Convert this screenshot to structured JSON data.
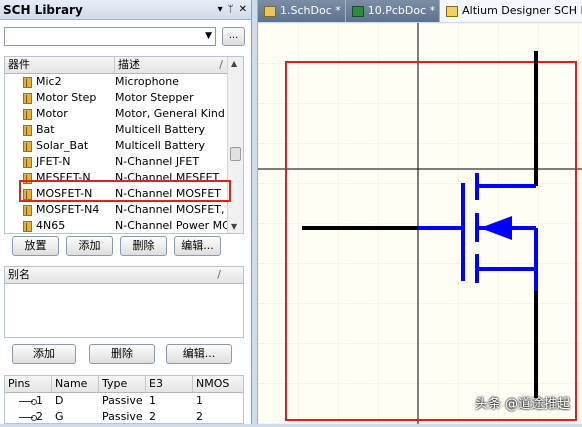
{
  "panel": {
    "title": "SCH Library",
    "ctrl_dropdown": "▾",
    "ctrl_pin": "ᛘ",
    "ctrl_close": "✕",
    "filter_value": "",
    "browse_label": "..."
  },
  "components": {
    "headers": [
      "器件",
      "描述"
    ],
    "rows": [
      {
        "name": "Mic2",
        "desc": "Microphone"
      },
      {
        "name": "Motor Step",
        "desc": "Motor Stepper"
      },
      {
        "name": "Motor",
        "desc": "Motor, General Kind"
      },
      {
        "name": "Bat",
        "desc": "Multicell Battery"
      },
      {
        "name": "Solar_Bat",
        "desc": "Multicell Battery"
      },
      {
        "name": "JFET-N",
        "desc": "N-Channel JFET"
      },
      {
        "name": "MESFET-N",
        "desc": "N-Channel MESFET"
      },
      {
        "name": "MOSFET-N",
        "desc": "N-Channel MOSFET"
      },
      {
        "name": "MOSFET-N4",
        "desc": "N-Channel MOSFET, I"
      },
      {
        "name": "4N65",
        "desc": "N-Channel Power MC"
      }
    ],
    "buttons": [
      "放置",
      "添加",
      "删除",
      "编辑..."
    ]
  },
  "alias": {
    "header": "别名",
    "buttons": [
      "添加",
      "删除",
      "编辑..."
    ]
  },
  "pins": {
    "headers": [
      "Pins",
      "Name",
      "Type",
      "E3",
      "NMOS"
    ],
    "rows": [
      {
        "num": "1",
        "name": "D",
        "type": "Passive",
        "e3": "1",
        "nmos": "1"
      },
      {
        "num": "2",
        "name": "G",
        "type": "Passive",
        "e3": "2",
        "nmos": "2"
      }
    ]
  },
  "tabs": [
    {
      "label": "1.SchDoc *",
      "active": false
    },
    {
      "label": "10.PcbDoc *",
      "active": false
    },
    {
      "label": "Altium Designer SCH Li",
      "active": true
    }
  ],
  "watermark": "头条 @道途推起",
  "colors": {
    "symbol_blue": "#0000ff",
    "wire_black": "#000000",
    "highlight_red": "#e02020",
    "canvas_bg": "#fffdf4"
  }
}
